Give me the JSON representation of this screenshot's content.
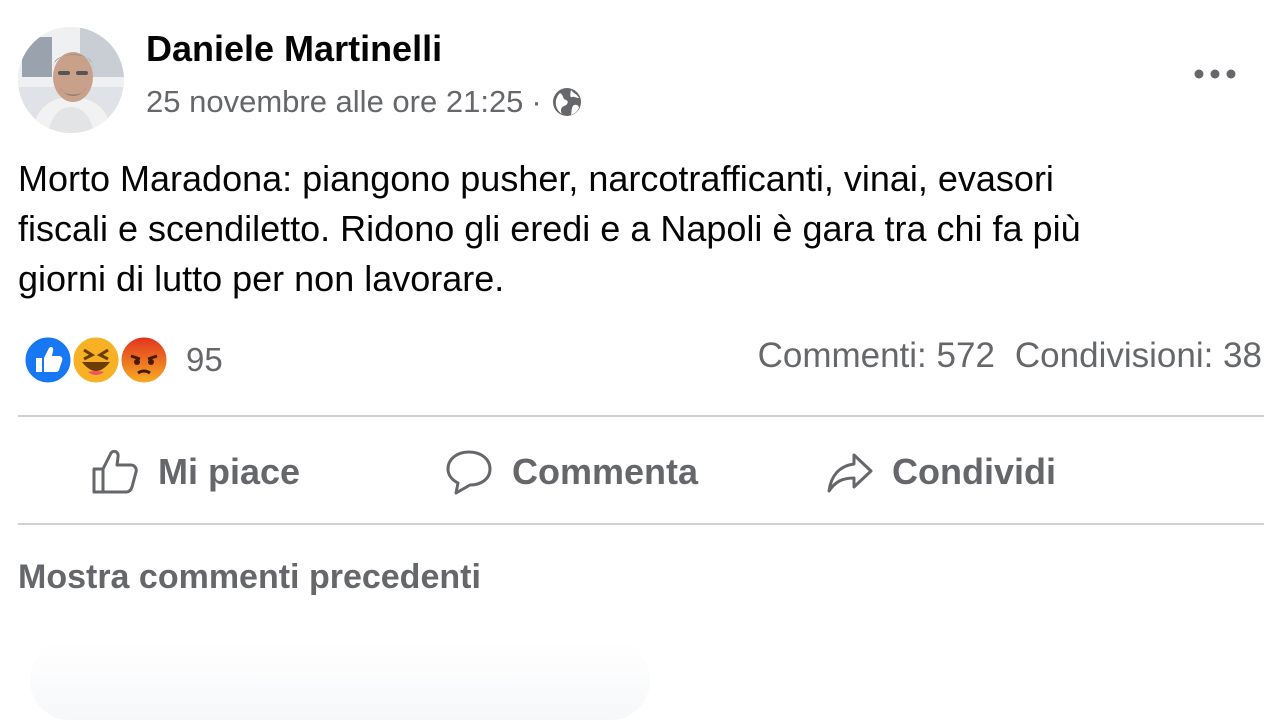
{
  "post": {
    "author": "Daniele Martinelli",
    "date": "25 novembre alle ore 21:25",
    "separator": "·",
    "privacy_icon": "globe-icon",
    "more_icon": "more-horizontal-icon",
    "text_lines": [
      "Morto Maradona: piangono pusher, narcotrafficanti, vinai, evasori",
      "fiscali e scendiletto. Ridono gli eredi e a Napoli è gara tra chi fa più",
      "giorni di lutto per non lavorare."
    ]
  },
  "reactions": {
    "icons": [
      "like-reaction-icon",
      "haha-reaction-icon",
      "angry-reaction-icon"
    ],
    "count": "95",
    "comments": "Commenti: 572",
    "shares": "Condivisioni: 38"
  },
  "actions": {
    "like_label": "Mi piace",
    "comment_label": "Commenta",
    "share_label": "Condividi"
  },
  "comments": {
    "show_previous": "Mostra commenti precedenti"
  },
  "colors": {
    "like_blue": "#1877f2",
    "haha_yellow": "#f7b125",
    "angry_orange": "#e9710f",
    "secondary_text": "#65676b"
  }
}
